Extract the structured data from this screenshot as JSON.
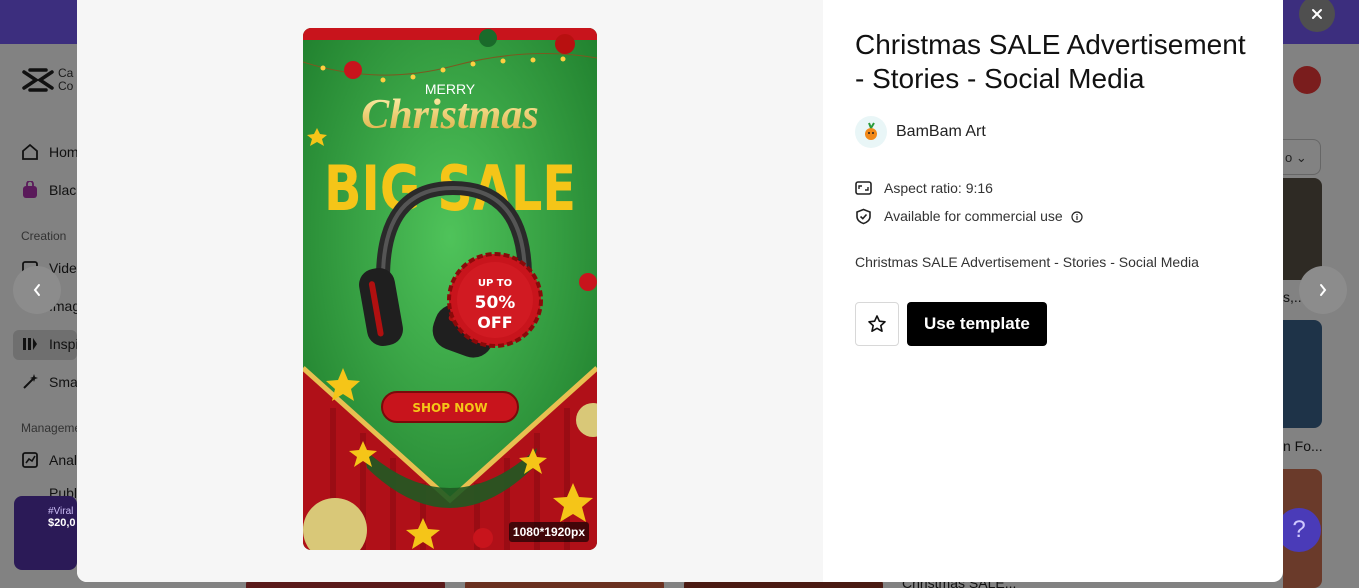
{
  "background": {
    "logo_text": "Ca Co",
    "nav_items": [
      {
        "label": "Home",
        "icon": "home-icon"
      },
      {
        "label": "Black",
        "icon": "bag-icon"
      },
      {
        "label": "Videos",
        "icon": "video-icon"
      },
      {
        "label": "Images",
        "icon": "image-icon"
      },
      {
        "label": "Inspiration",
        "icon": "inspiration-icon"
      },
      {
        "label": "Smart",
        "icon": "wand-icon"
      },
      {
        "label": "Analytics",
        "icon": "chart-icon"
      },
      {
        "label": "Publish",
        "icon": "calendar-icon"
      }
    ],
    "section_creation": "Creation",
    "section_management": "Management",
    "promo_tag": "#Viral",
    "promo_amount": "$20,0",
    "select_value": "o",
    "thumb_captions": [
      "s,...",
      "n Fo..."
    ],
    "bottom_caption": "Christmas SALE..."
  },
  "modal": {
    "title": "Christmas SALE Advertisement - Stories - Social Media",
    "author": {
      "name": "BamBam Art",
      "icon": "author-avatar-icon"
    },
    "aspect_ratio": "Aspect ratio: 9:16",
    "commercial": "Available for commercial use",
    "description": "Christmas SALE Advertisement - Stories - Social Media",
    "use_template_label": "Use template",
    "poster": {
      "merry": "MERRY",
      "christmas": "Christmas",
      "big_sale": "BIG SALE",
      "up_to": "UP TO",
      "percent": "50%",
      "off": "OFF",
      "shop_now": "SHOP NOW",
      "size_badge": "1080*1920px"
    }
  },
  "colors": {
    "accent": "#000000",
    "poster_green": "#2f9a3c",
    "poster_red": "#c8141c",
    "poster_gold": "#f5c518"
  }
}
